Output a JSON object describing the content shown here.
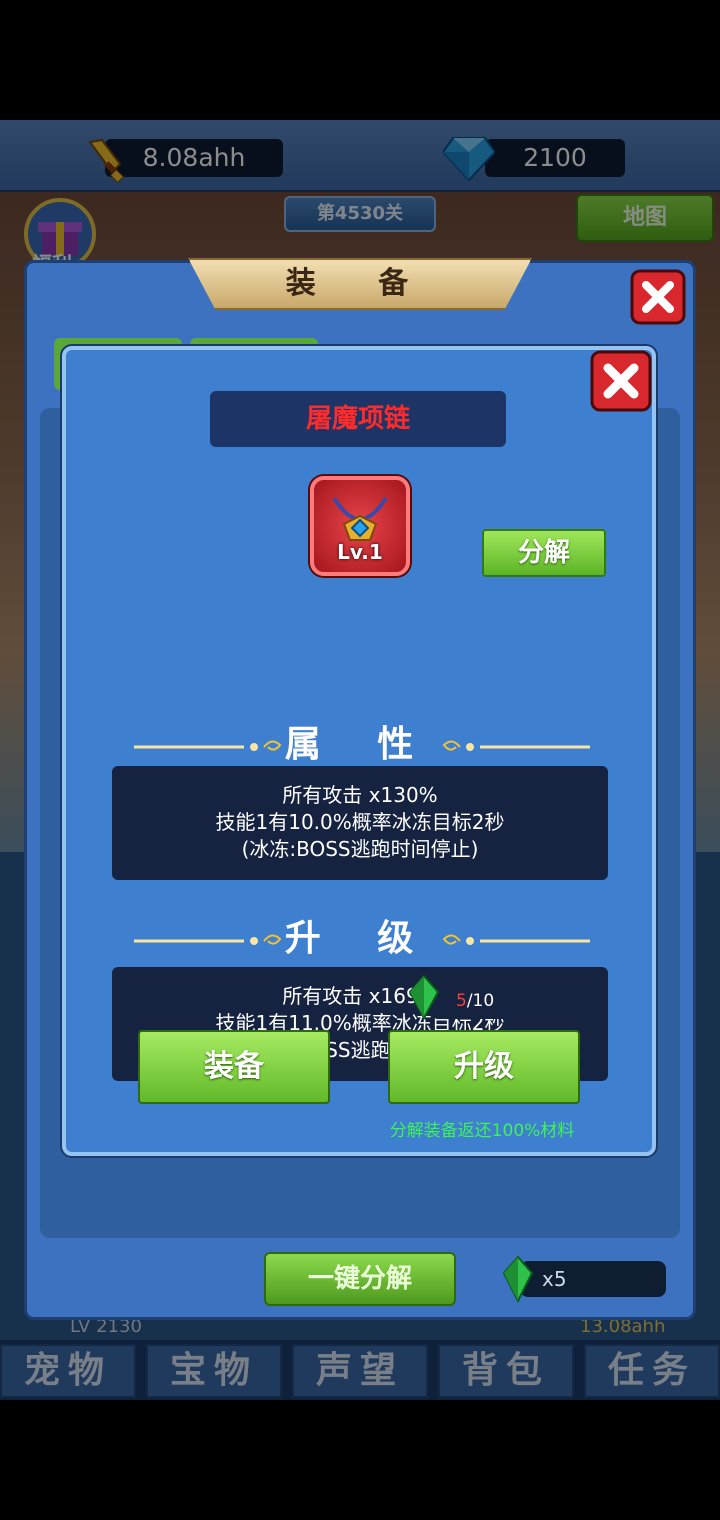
{
  "resources": {
    "gold": "8.08ahh",
    "gems": "2100"
  },
  "scene": {
    "stage": "第4530关",
    "map_button": "地图",
    "welfare_label": "福利",
    "level_label": "LV 2130",
    "gold_label": "13.08ahh"
  },
  "equip_panel": {
    "title": "装 备",
    "oneclick_button": "一键分解",
    "material_count": "x5"
  },
  "item": {
    "name": "屠魔项链",
    "level": "Lv.1",
    "decompose_button": "分解",
    "attributes_heading": "属 性",
    "attributes": [
      "所有攻击 x130%",
      "技能1有10.0%概率冰冻目标2秒",
      "(冰冻:BOSS逃跑时间停止)"
    ],
    "upgrade_heading": "升 级",
    "upgrade_preview": [
      "所有攻击 x169%",
      "技能1有11.0%概率冰冻目标2秒",
      "(冰冻:BOSS逃跑时间停止)"
    ],
    "upgrade_cost_current": "5",
    "upgrade_cost_total": "/10",
    "equip_button": "装备",
    "upgrade_button": "升级",
    "refund_note": "分解装备返还100%材料"
  },
  "nav": {
    "tabs": [
      "宠物",
      "宝物",
      "声望",
      "背包",
      "任务"
    ]
  },
  "colors": {
    "item_name": "#ff2a2a",
    "button_green": "#62b92a",
    "refund_note": "#3ef25a",
    "dialog_bg": "#3f7fd0"
  },
  "icons": [
    "sword-icon",
    "diamond-icon",
    "close-icon",
    "necklace-icon",
    "crystal-icon",
    "welfare-icon"
  ]
}
